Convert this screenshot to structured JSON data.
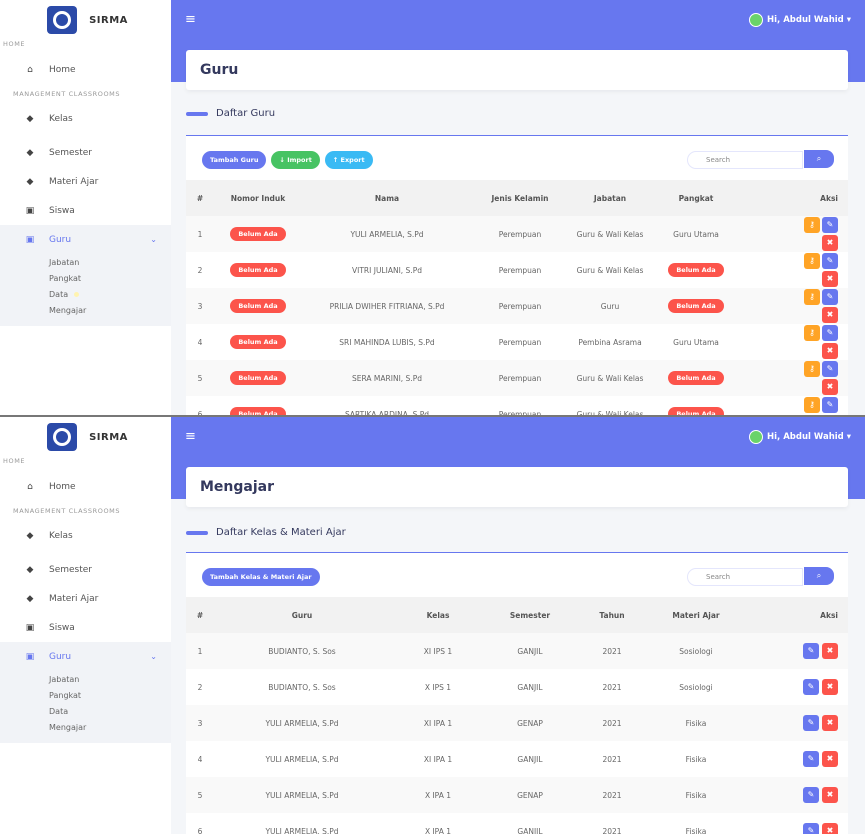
{
  "app": {
    "brand": "SIRMA",
    "user": "Hi, Abdul Wahid"
  },
  "sidebar": {
    "home_header": "HOME",
    "home": "Home",
    "mgmt_header": "MANAGEMENT CLASSROOMS",
    "items": [
      "Kelas",
      "Semester",
      "Materi Ajar",
      "Siswa",
      "Guru"
    ],
    "sub": [
      "Jabatan",
      "Pangkat",
      "Data",
      "Mengajar"
    ]
  },
  "guru": {
    "title": "Guru",
    "section": "Daftar Guru",
    "btn_add": "Tambah Guru",
    "btn_import": "Import",
    "btn_export": "Export",
    "search": "Search",
    "headers": [
      "#",
      "Nomor Induk",
      "Nama",
      "Jenis Kelamin",
      "Jabatan",
      "Pangkat",
      "Aksi"
    ],
    "rows": [
      [
        "1",
        "Belum Ada",
        "YULI ARMELIA, S.Pd",
        "Perempuan",
        "Guru & Wali Kelas",
        "Guru Utama"
      ],
      [
        "2",
        "Belum Ada",
        "VITRI JULIANI, S.Pd",
        "Perempuan",
        "Guru & Wali Kelas",
        "Belum Ada"
      ],
      [
        "3",
        "Belum Ada",
        "PRILIA DWIHER FITRIANA, S.Pd",
        "Perempuan",
        "Guru",
        "Belum Ada"
      ],
      [
        "4",
        "Belum Ada",
        "SRI MAHINDA LUBIS, S.Pd",
        "Perempuan",
        "Pembina Asrama",
        "Guru Utama"
      ],
      [
        "5",
        "Belum Ada",
        "SERA MARINI, S.Pd",
        "Perempuan",
        "Guru & Wali Kelas",
        "Belum Ada"
      ],
      [
        "6",
        "Belum Ada",
        "SARTIKA ARDINA, S.Pd",
        "Perempuan",
        "Guru & Wali Kelas",
        "Belum Ada"
      ]
    ]
  },
  "mengajar": {
    "title": "Mengajar",
    "section": "Daftar Kelas & Materi Ajar",
    "btn_add": "Tambah Kelas & Materi Ajar",
    "search": "Search",
    "headers": [
      "#",
      "Guru",
      "Kelas",
      "Semester",
      "Tahun",
      "Materi Ajar",
      "Aksi"
    ],
    "rows": [
      [
        "1",
        "BUDIANTO, S. Sos",
        "XI IPS 1",
        "GANJIL",
        "2021",
        "Sosiologi"
      ],
      [
        "2",
        "BUDIANTO, S. Sos",
        "X IPS 1",
        "GANJIL",
        "2021",
        "Sosiologi"
      ],
      [
        "3",
        "YULI ARMELIA, S.Pd",
        "XI IPA 1",
        "GENAP",
        "2021",
        "Fisika"
      ],
      [
        "4",
        "YULI ARMELIA, S.Pd",
        "XI IPA 1",
        "GANJIL",
        "2021",
        "Fisika"
      ],
      [
        "5",
        "YULI ARMELIA, S.Pd",
        "X IPA 1",
        "GENAP",
        "2021",
        "Fisika"
      ],
      [
        "6",
        "YULI ARMELIA, S.Pd",
        "X IPA 1",
        "GANJIL",
        "2021",
        "Fisika"
      ]
    ]
  },
  "colors": {
    "primary": "#6777ef",
    "danger": "#fc544b",
    "success": "#47c363",
    "info": "#3abaf4",
    "warning": "#ffa426"
  }
}
